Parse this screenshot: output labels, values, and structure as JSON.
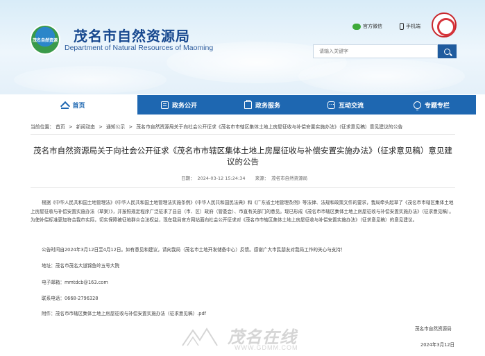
{
  "header": {
    "logo_text": "茂名自然资源",
    "title": "茂名市自然资源局",
    "subtitle": "Department of Natural Resources of Maoming",
    "wechat_label": "官方微信",
    "mobile_label": "手机端",
    "search_placeholder": "请输入关键字"
  },
  "nav": {
    "items": [
      {
        "label": "首页",
        "icon": "home-icon",
        "active": true
      },
      {
        "label": "政务公开",
        "icon": "document-icon",
        "active": false
      },
      {
        "label": "政务服务",
        "icon": "briefcase-icon",
        "active": false
      },
      {
        "label": "互动交流",
        "icon": "chat-icon",
        "active": false
      },
      {
        "label": "专题专栏",
        "icon": "trophy-icon",
        "active": false
      }
    ]
  },
  "breadcrumb": {
    "prefix": "当前位置：",
    "items": [
      "首页",
      "新闻动态",
      "通知公示",
      "茂名市自然资源局关于向社会公开征求《茂名市市辖区集体土地上房屋征收与补偿安置实施办法》（征求意见稿）意见建议的公告"
    ]
  },
  "article": {
    "title": "茂名市自然资源局关于向社会公开征求《茂名市市辖区集体土地上房屋征收与补偿安置实施办法》（征求意见稿）意见建议的公告",
    "date_label": "日期：",
    "date": "2024-03-12 15:24:34",
    "source_label": "来源：",
    "source": "茂名市自然资源局",
    "paragraph1": "根据《中华人民共和国土地管理法》《中华人民共和国土地管理法实施条例》《中华人民共和国民法典》和《广东省土地管理条例》等法律、法规和政策文件的要求，我局牵头起草了《茂名市市辖区集体土地上房屋征收与补偿安置实施办法（草案）》，并按照规定程序广泛征求了县县（市、区）政府（管委会）、市直有关部门的意见。现已形成《茂名市市辖区集体土地上房屋征收与补偿安置实施办法》（征求意见稿）。为使补偿标准更加符合我市实际，切实保障被征地群众合法权益，现在我局官方网站面向社会公开征求对《茂名市市辖区集体土地上房屋征收与补偿安置实施办法》（征求意见稿）的意见建议。",
    "paragraph2": "公告时间自2024年3月12日至4月12日。如有意见和建议，请向我局（茂名市土地开发储备中心）反馈。感谢广大市民朋友对我局工作的关心与支持！",
    "address": "地址：茂名市茂名大道锦鱼岭五号大院",
    "email": "电子邮箱：mmtdcb@163.com",
    "phone": "联系电话：0668-2796328",
    "attachment_label": "附件：",
    "attachment": "茂名市市辖区集体土地上房屋征收与补偿安置实施办法（征求意见稿）.pdf",
    "sign_org": "茂名市自然资源局",
    "sign_date": "2024年3月12日"
  },
  "watermark": {
    "text_cn": "茂名在线",
    "url": "WWW.GDMM.COM"
  },
  "colors": {
    "brand_blue": "#1e67b1",
    "title_blue": "#16478e",
    "search_button": "#1f5b9e"
  }
}
